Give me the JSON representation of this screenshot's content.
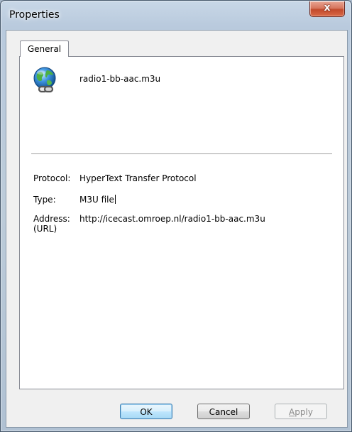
{
  "window": {
    "title": "Properties",
    "close_glyph": "x"
  },
  "tabs": [
    {
      "label": "General"
    }
  ],
  "file": {
    "name": "radio1-bb-aac.m3u",
    "icon": "internet-shortcut-globe-icon"
  },
  "properties": {
    "protocol_label": "Protocol:",
    "protocol_value": "HyperText Transfer Protocol",
    "type_label": "Type:",
    "type_value": "M3U file",
    "address_label_line1": "Address:",
    "address_label_line2": "(URL)",
    "address_value": "http://icecast.omroep.nl/radio1-bb-aac.m3u"
  },
  "buttons": {
    "ok": "OK",
    "cancel": "Cancel",
    "apply_accel": "A",
    "apply_rest": "pply"
  },
  "colors": {
    "frame": "#b9cadd",
    "close_button": "#c24a2c",
    "default_button_border": "#3c7fb1"
  }
}
